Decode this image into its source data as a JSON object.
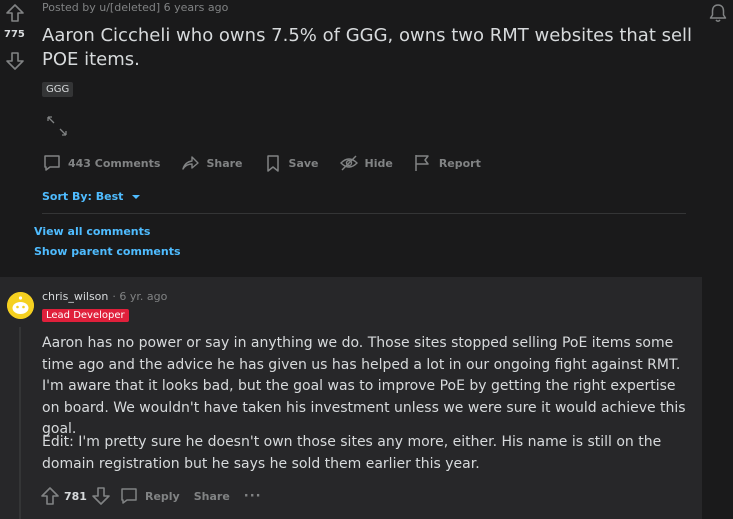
{
  "post": {
    "meta": "Posted by u/[deleted] 6 years ago",
    "score": "775",
    "title": "Aaron Ciccheli who owns 7.5% of GGG, owns two RMT websites that sell POE items.",
    "flair": "GGG",
    "actions": {
      "comments": "443 Comments",
      "share": "Share",
      "save": "Save",
      "hide": "Hide",
      "report": "Report"
    }
  },
  "sort": {
    "label": "Sort By: Best"
  },
  "links": {
    "view_all": "View all comments",
    "show_parent": "Show parent comments"
  },
  "comment": {
    "username": "chris_wilson",
    "time": "· 6 yr. ago",
    "flair": "Lead Developer",
    "paragraph1": "Aaron has no power or say in anything we do. Those sites stopped selling PoE items some time ago and the advice he has given us has helped a lot in our ongoing fight against RMT. I'm aware that it looks bad, but the goal was to improve PoE by getting the right expertise on board. We wouldn't have taken his investment unless we were sure it would achieve this goal.",
    "paragraph2": "Edit: I'm pretty sure he doesn't own those sites any more, either. His name is still on the domain registration but he says he sold them earlier this year.",
    "score": "781",
    "reply": "Reply",
    "share": "Share",
    "more": "···"
  },
  "colors": {
    "background": "#1a1a1b",
    "comment_bg": "#272729",
    "link_blue": "#4fbcff",
    "lead_flair": "#e0203b",
    "avatar_yellow": "#f5d020"
  }
}
